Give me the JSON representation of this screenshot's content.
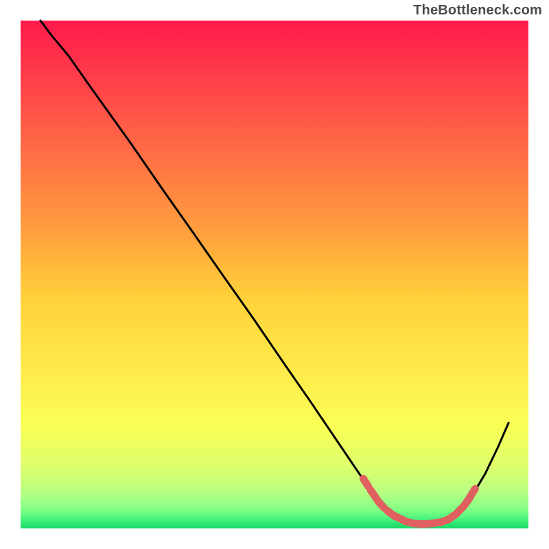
{
  "watermark": "TheBottleneck.com",
  "chart_data": {
    "type": "line",
    "title": "",
    "xlabel": "",
    "ylabel": "",
    "xlim": [
      0,
      100
    ],
    "ylim": [
      0,
      100
    ],
    "grid": false,
    "legend": false,
    "notes": "Gradient background from red (top) through orange/yellow to green (bottom). Black curve: steep descent from upper-left, reaches near-zero across a flat valley ~x=70–85, then rises toward the right edge. Salmon dotted segment highlights the valley region along the curve.",
    "gradient_stops": [
      {
        "offset": 0.0,
        "color": "#ff1a4b"
      },
      {
        "offset": 0.1,
        "color": "#ff3a4a"
      },
      {
        "offset": 0.25,
        "color": "#ff6a46"
      },
      {
        "offset": 0.4,
        "color": "#ff9a3e"
      },
      {
        "offset": 0.55,
        "color": "#ffd23a"
      },
      {
        "offset": 0.68,
        "color": "#ffe94a"
      },
      {
        "offset": 0.8,
        "color": "#f9ff55"
      },
      {
        "offset": 0.88,
        "color": "#dcff6e"
      },
      {
        "offset": 0.93,
        "color": "#b6ff82"
      },
      {
        "offset": 0.965,
        "color": "#7dff84"
      },
      {
        "offset": 0.985,
        "color": "#3ef07a"
      },
      {
        "offset": 1.0,
        "color": "#17d765"
      }
    ],
    "series": [
      {
        "name": "bottleneck-curve",
        "stroke": "#000000",
        "points": [
          {
            "x": 3.9,
            "y": 100.0
          },
          {
            "x": 6.0,
            "y": 97.2
          },
          {
            "x": 9.5,
            "y": 93.0
          },
          {
            "x": 13.0,
            "y": 88.0
          },
          {
            "x": 17.0,
            "y": 82.4
          },
          {
            "x": 22.0,
            "y": 75.4
          },
          {
            "x": 28.0,
            "y": 66.7
          },
          {
            "x": 34.0,
            "y": 58.2
          },
          {
            "x": 40.0,
            "y": 49.6
          },
          {
            "x": 46.0,
            "y": 41.1
          },
          {
            "x": 52.0,
            "y": 32.3
          },
          {
            "x": 57.0,
            "y": 25.1
          },
          {
            "x": 62.0,
            "y": 17.7
          },
          {
            "x": 66.0,
            "y": 11.8
          },
          {
            "x": 69.0,
            "y": 7.4
          },
          {
            "x": 71.5,
            "y": 4.4
          },
          {
            "x": 74.0,
            "y": 2.3
          },
          {
            "x": 76.5,
            "y": 1.2
          },
          {
            "x": 79.0,
            "y": 0.8
          },
          {
            "x": 81.5,
            "y": 1.0
          },
          {
            "x": 84.0,
            "y": 1.7
          },
          {
            "x": 86.5,
            "y": 3.5
          },
          {
            "x": 89.0,
            "y": 6.6
          },
          {
            "x": 91.5,
            "y": 10.8
          },
          {
            "x": 94.0,
            "y": 16.0
          },
          {
            "x": 96.1,
            "y": 20.8
          }
        ]
      },
      {
        "name": "valley-dots",
        "stroke": "#e06060",
        "style": "dotted",
        "points": [
          {
            "x": 68.0,
            "y": 9.0
          },
          {
            "x": 69.5,
            "y": 6.7
          },
          {
            "x": 71.0,
            "y": 4.7
          },
          {
            "x": 73.0,
            "y": 2.9
          },
          {
            "x": 74.8,
            "y": 1.9
          },
          {
            "x": 76.5,
            "y": 1.2
          },
          {
            "x": 78.3,
            "y": 0.9
          },
          {
            "x": 80.0,
            "y": 0.9
          },
          {
            "x": 81.7,
            "y": 1.1
          },
          {
            "x": 83.5,
            "y": 1.5
          },
          {
            "x": 85.0,
            "y": 2.3
          },
          {
            "x": 86.5,
            "y": 3.6
          },
          {
            "x": 88.0,
            "y": 5.4
          },
          {
            "x": 89.0,
            "y": 7.0
          }
        ]
      }
    ]
  }
}
